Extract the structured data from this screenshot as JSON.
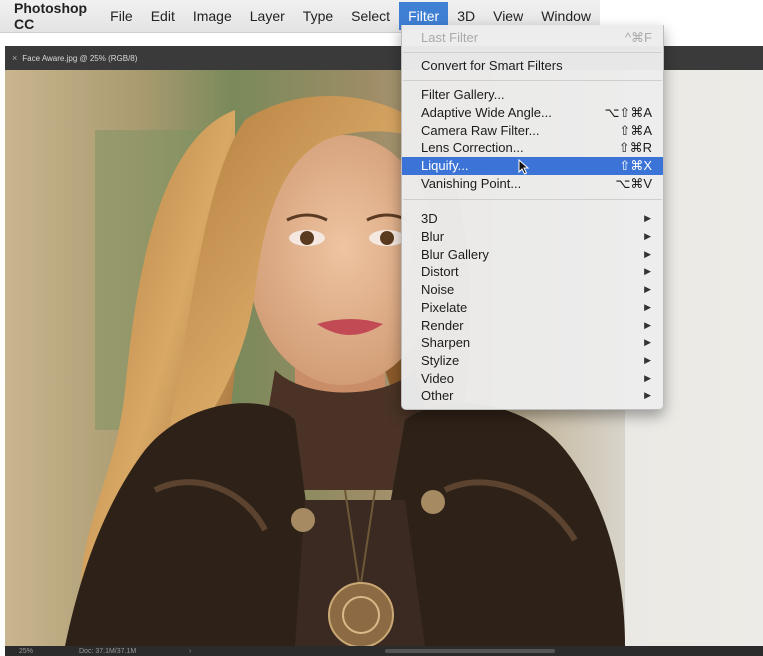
{
  "menubar": {
    "app": "Photoshop CC",
    "items": [
      "File",
      "Edit",
      "Image",
      "Layer",
      "Type",
      "Select",
      "Filter",
      "3D",
      "View",
      "Window"
    ],
    "active": "Filter"
  },
  "document": {
    "tab_title": "Face Aware.jpg @ 25% (RGB/8)",
    "close_glyph": "×",
    "status_zoom": "25%",
    "status_doc": "Doc: 37.1M/37.1M",
    "status_arrow": "›"
  },
  "filter_menu": {
    "last_filter": {
      "label": "Last Filter",
      "shortcut": "^⌘F"
    },
    "convert": {
      "label": "Convert for Smart Filters"
    },
    "filter_gallery": {
      "label": "Filter Gallery..."
    },
    "adaptive": {
      "label": "Adaptive Wide Angle...",
      "shortcut": "⌥⇧⌘A"
    },
    "camera_raw": {
      "label": "Camera Raw Filter...",
      "shortcut": "⇧⌘A"
    },
    "lens": {
      "label": "Lens Correction...",
      "shortcut": "⇧⌘R"
    },
    "liquify": {
      "label": "Liquify...",
      "shortcut": "⇧⌘X"
    },
    "vanishing": {
      "label": "Vanishing Point...",
      "shortcut": "⌥⌘V"
    },
    "submenu_arrow": "▶",
    "submenus": [
      "3D",
      "Blur",
      "Blur Gallery",
      "Distort",
      "Noise",
      "Pixelate",
      "Render",
      "Sharpen",
      "Stylize",
      "Video",
      "Other"
    ]
  },
  "colors": {
    "menu_highlight": "#3b74d6",
    "menubar_active": "#3f7fd4"
  }
}
